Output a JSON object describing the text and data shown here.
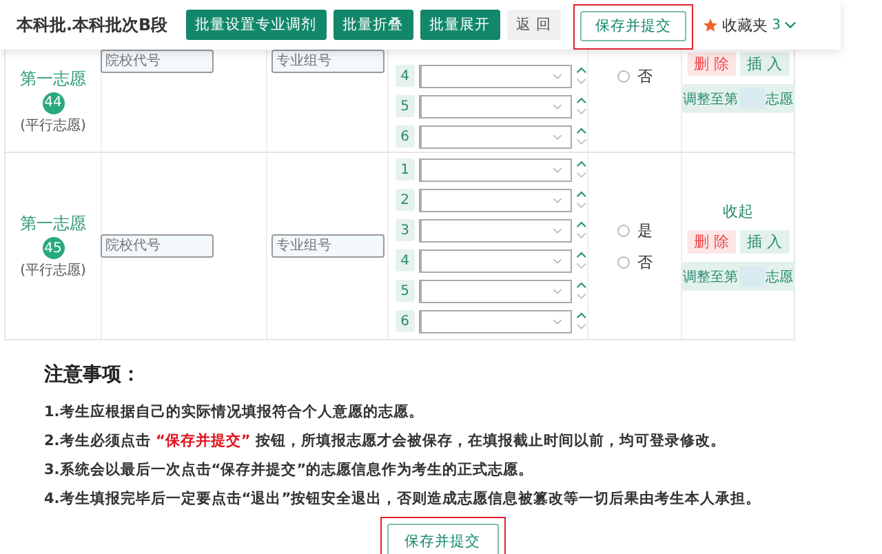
{
  "header": {
    "title": "本科批.本科批次B段",
    "buttons": [
      {
        "label": "批量设置专业调剂",
        "kind": "primary",
        "highlighted": false
      },
      {
        "label": "批量折叠",
        "kind": "primary",
        "highlighted": false
      },
      {
        "label": "批量展开",
        "kind": "primary",
        "highlighted": false
      },
      {
        "label": "返 回",
        "kind": "secondary",
        "highlighted": false
      },
      {
        "label": "保存并提交",
        "kind": "outline",
        "highlighted": true
      }
    ],
    "favorites": {
      "label": "收藏夹",
      "count": "3"
    }
  },
  "choices": [
    {
      "title": "第一志愿",
      "number": "44",
      "type": "(平行志愿)",
      "school_placeholder": "院校代号",
      "group_placeholder": "专业组号",
      "majors": [
        {
          "number": "4"
        },
        {
          "number": "5"
        },
        {
          "number": "6"
        }
      ],
      "adjust_options": [
        {
          "label": "否",
          "selected": false
        }
      ],
      "delete": "删 除",
      "insert": "插 入",
      "move_prefix": "调整至第",
      "move_suffix": "志愿"
    },
    {
      "title": "第一志愿",
      "number": "45",
      "type": "(平行志愿)",
      "school_placeholder": "院校代号",
      "group_placeholder": "专业组号",
      "majors": [
        {
          "number": "1"
        },
        {
          "number": "2"
        },
        {
          "number": "3"
        },
        {
          "number": "4"
        },
        {
          "number": "5"
        },
        {
          "number": "6"
        }
      ],
      "adjust_options": [
        {
          "label": "是",
          "selected": false
        },
        {
          "label": "否",
          "selected": false
        }
      ],
      "collapse": "收起",
      "delete": "删 除",
      "insert": "插 入",
      "move_prefix": "调整至第",
      "move_suffix": "志愿"
    }
  ],
  "notes": {
    "title": "注意事项：",
    "items": [
      "1.考生应根据自己的实际情况填报符合个人意愿的志愿。",
      "2.考生必须点击 **“保存并提交”** 按钮，所填报志愿才会被保存，在填报截止时间以前，均可登录修改。",
      "3.系统会以最后一次点击“保存并提交”的志愿信息作为考生的正式志愿。",
      "4.考生填报完毕后一定要点击“退出”按钮安全退出，否则造成志愿信息被篡改等一切后果由考生本人承担。"
    ]
  },
  "footer_button": {
    "label": "保存并提交",
    "highlighted": true
  }
}
